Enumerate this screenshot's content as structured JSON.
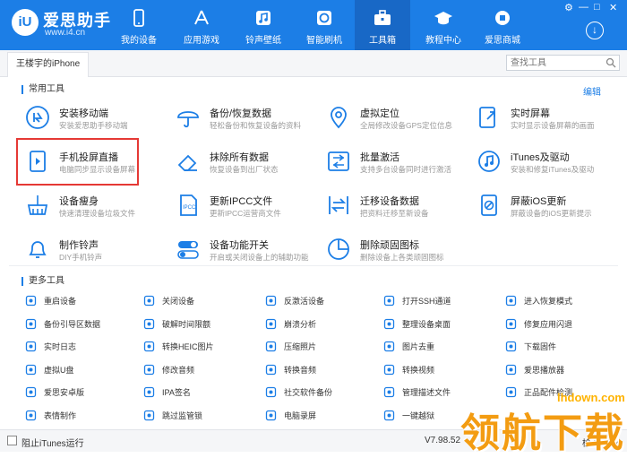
{
  "brand": {
    "logo_text": "iU",
    "name": "爱思助手",
    "url": "www.i4.cn"
  },
  "nav": [
    {
      "label": "我的设备",
      "icon": "apple-icon"
    },
    {
      "label": "应用游戏",
      "icon": "appstore-icon"
    },
    {
      "label": "铃声壁纸",
      "icon": "music-icon"
    },
    {
      "label": "智能刷机",
      "icon": "flash-icon"
    },
    {
      "label": "工具箱",
      "icon": "toolbox-icon"
    },
    {
      "label": "教程中心",
      "icon": "graduation-icon"
    },
    {
      "label": "爱思商城",
      "icon": "shop-icon"
    }
  ],
  "window": {
    "controls": [
      "⚙",
      "—",
      "□",
      "✕"
    ],
    "download_icon": "↓"
  },
  "device_tab": "王楼宇的iPhone",
  "search": {
    "placeholder": "查找工具"
  },
  "common": {
    "title": "常用工具",
    "edit": "编辑",
    "tools": [
      {
        "name": "安装移动端",
        "desc": "安装爱思助手移动端",
        "icon": "i4-mobile-icon"
      },
      {
        "name": "备份/恢复数据",
        "desc": "轻松备份和恢复设备的资料",
        "icon": "umbrella-icon"
      },
      {
        "name": "虚拟定位",
        "desc": "全局修改设备GPS定位信息",
        "icon": "location-pin-icon"
      },
      {
        "name": "实时屏幕",
        "desc": "实时显示设备屏幕的画面",
        "icon": "screen-cast-icon"
      },
      {
        "name": "手机投屏直播",
        "desc": "电脑同步显示设备屏幕",
        "icon": "screen-mirror-icon"
      },
      {
        "name": "抹除所有数据",
        "desc": "恢复设备到出厂状态",
        "icon": "eraser-icon"
      },
      {
        "name": "批量激活",
        "desc": "支持多台设备同时进行激活",
        "icon": "batch-activate-icon"
      },
      {
        "name": "iTunes及驱动",
        "desc": "安装和修复iTunes及驱动",
        "icon": "itunes-icon"
      },
      {
        "name": "设备瘦身",
        "desc": "快速清理设备垃圾文件",
        "icon": "broom-icon"
      },
      {
        "name": "更新IPCC文件",
        "desc": "更新IPCC运营商文件",
        "icon": "ipcc-file-icon"
      },
      {
        "name": "迁移设备数据",
        "desc": "把资料迁移至新设备",
        "icon": "migrate-icon"
      },
      {
        "name": "屏蔽iOS更新",
        "desc": "屏蔽设备的iOS更新提示",
        "icon": "block-update-icon"
      },
      {
        "name": "制作铃声",
        "desc": "DIY手机铃声",
        "icon": "bell-icon"
      },
      {
        "name": "设备功能开关",
        "desc": "开启或关闭设备上的辅助功能",
        "icon": "toggle-icon"
      },
      {
        "name": "删除顽固图标",
        "desc": "删除设备上各类顽固图标",
        "icon": "pie-icon"
      }
    ]
  },
  "more": {
    "title": "更多工具",
    "tools": [
      {
        "label": "重启设备",
        "icon": "restart-icon"
      },
      {
        "label": "关闭设备",
        "icon": "power-icon"
      },
      {
        "label": "反激活设备",
        "icon": "deactivate-icon"
      },
      {
        "label": "打开SSH通道",
        "icon": "ssh-icon"
      },
      {
        "label": "进入恢复模式",
        "icon": "recovery-icon"
      },
      {
        "label": "备份引导区数据",
        "icon": "backup-boot-icon"
      },
      {
        "label": "破解时间限额",
        "icon": "hourglass-icon"
      },
      {
        "label": "崩溃分析",
        "icon": "crash-analysis-icon"
      },
      {
        "label": "整理设备桌面",
        "icon": "desktop-organize-icon"
      },
      {
        "label": "修复应用闪退",
        "icon": "app-repair-icon"
      },
      {
        "label": "实时日志",
        "icon": "log-icon"
      },
      {
        "label": "转换HEIC图片",
        "icon": "heic-icon"
      },
      {
        "label": "压缩照片",
        "icon": "compress-photo-icon"
      },
      {
        "label": "图片去重",
        "icon": "dedupe-photo-icon"
      },
      {
        "label": "下载固件",
        "icon": "download-firmware-icon"
      },
      {
        "label": "虚拟U盘",
        "icon": "usb-drive-icon"
      },
      {
        "label": "修改音频",
        "icon": "audio-edit-icon"
      },
      {
        "label": "转换音频",
        "icon": "audio-convert-icon"
      },
      {
        "label": "转换视频",
        "icon": "video-convert-icon"
      },
      {
        "label": "爱思播放器",
        "icon": "player-icon"
      },
      {
        "label": "爱思安卓版",
        "icon": "android-icon"
      },
      {
        "label": "IPA签名",
        "icon": "ipa-sign-icon"
      },
      {
        "label": "社交软件备份",
        "icon": "social-backup-icon"
      },
      {
        "label": "管理描述文件",
        "icon": "profile-manage-icon"
      },
      {
        "label": "正品配件检测",
        "icon": "accessory-check-icon"
      },
      {
        "label": "表情制作",
        "icon": "emoji-icon"
      },
      {
        "label": "跳过监管锁",
        "icon": "lock-icon"
      },
      {
        "label": "电脑录屏",
        "icon": "screen-record-icon"
      },
      {
        "label": "一键越狱",
        "icon": "jailbreak-icon"
      }
    ]
  },
  "footer": {
    "itunes_label": "阻止iTunes运行",
    "version": "V7.98.52",
    "version_suffix": "检查更新"
  },
  "watermark": {
    "text": "领航下载",
    "site": "lhdown.com"
  },
  "colors": {
    "primary": "#1c7ee6",
    "nav_active": "#1868c6",
    "highlight": "#e53935",
    "watermark": "#f39c12"
  }
}
